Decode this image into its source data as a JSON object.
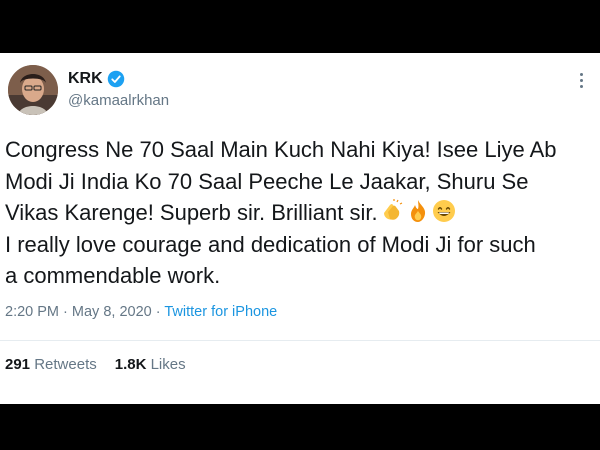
{
  "colors": {
    "frame": "#000000",
    "card": "#ffffff",
    "text": "#14171a",
    "muted": "#657786",
    "link": "#1b95e0",
    "verified": "#1da1f2"
  },
  "author": {
    "display_name": "KRK",
    "handle": "@kamaalrkhan",
    "verified": true,
    "avatar_icon": "profile-photo"
  },
  "tweet": {
    "lines": [
      "Congress Ne 70 Saal Main Kuch Nahi Kiya! Isee Liye Ab",
      "Modi Ji India Ko 70 Saal Peeche Le Jaakar, Shuru Se",
      "Vikas Karenge! Superb sir. Brilliant sir.",
      "I really love courage and dedication of Modi Ji for such",
      "a commendable work."
    ],
    "emojis": [
      "clapping-hands-icon",
      "fire-icon",
      "grinning-face-icon"
    ]
  },
  "meta": {
    "time": "2:20 PM",
    "separator": "·",
    "date": "May 8, 2020",
    "source": "Twitter for iPhone"
  },
  "stats": {
    "retweets_count": "291",
    "retweets_label": "Retweets",
    "likes_count": "1.8K",
    "likes_label": "Likes"
  }
}
